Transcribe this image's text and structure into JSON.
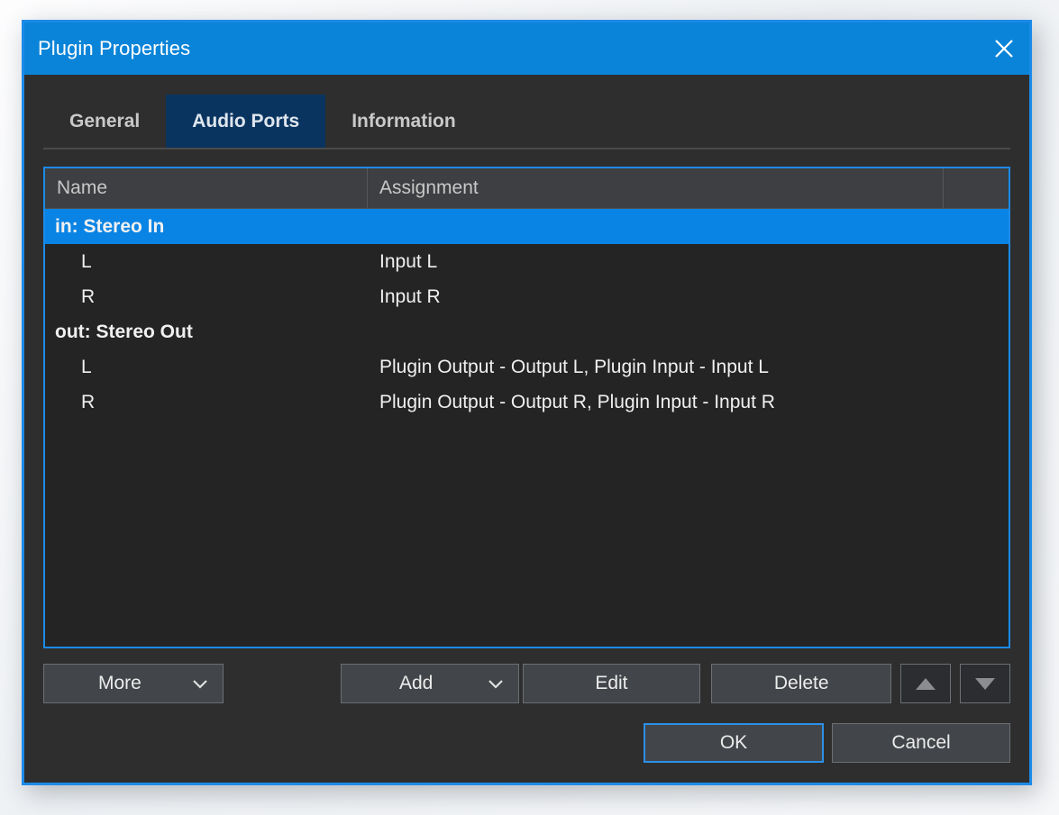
{
  "window": {
    "title": "Plugin Properties",
    "close_icon": "close-icon"
  },
  "tabs": [
    {
      "label": "General",
      "selected": false
    },
    {
      "label": "Audio Ports",
      "selected": true
    },
    {
      "label": "Information",
      "selected": false
    }
  ],
  "table": {
    "columns": [
      "Name",
      "Assignment",
      ""
    ],
    "rows": [
      {
        "name": "in: Stereo In",
        "assignment": "",
        "type": "group",
        "selected": true
      },
      {
        "name": "L",
        "assignment": "Input L",
        "type": "child",
        "selected": false
      },
      {
        "name": "R",
        "assignment": "Input R",
        "type": "child",
        "selected": false
      },
      {
        "name": "out: Stereo Out",
        "assignment": "",
        "type": "group",
        "selected": false
      },
      {
        "name": "L",
        "assignment": "Plugin Output - Output L, Plugin Input - Input L",
        "type": "child",
        "selected": false
      },
      {
        "name": "R",
        "assignment": "Plugin Output - Output R, Plugin Input - Input R",
        "type": "child",
        "selected": false
      }
    ]
  },
  "toolbar": {
    "more_label": "More",
    "add_label": "Add",
    "edit_label": "Edit",
    "delete_label": "Delete",
    "move_up_icon": "triangle-up-icon",
    "move_down_icon": "triangle-down-icon",
    "dropdown_icon": "chevron-down-icon"
  },
  "footer": {
    "ok_label": "OK",
    "cancel_label": "Cancel"
  },
  "colors": {
    "accent": "#0a84d8",
    "selection": "#0a84e4",
    "tab_selected": "#0a3460",
    "dialog_bg": "#2e2e2e",
    "list_bg": "#242424",
    "focus_border": "#1c8ae8"
  }
}
